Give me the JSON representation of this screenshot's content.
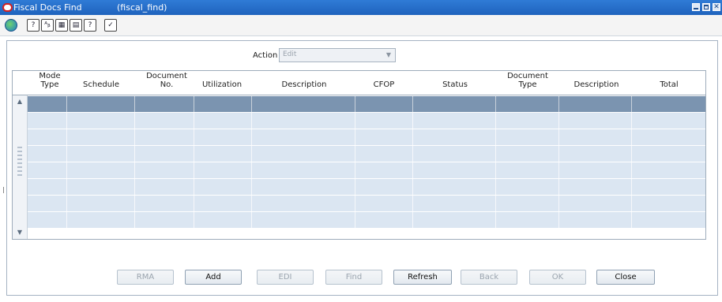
{
  "window": {
    "title": "Fiscal Docs Find",
    "form_name": "(fiscal_find)",
    "controls": [
      "minimize",
      "maximize",
      "close"
    ],
    "close_glyph": "✕"
  },
  "toolbar": {
    "icons": [
      {
        "name": "globe-icon",
        "glyph": ""
      },
      {
        "name": "help-icon",
        "glyph": "?"
      },
      {
        "name": "spell-check-icon",
        "glyph": "ᴬᵦ"
      },
      {
        "name": "calendar-icon",
        "glyph": "▦"
      },
      {
        "name": "print-icon",
        "glyph": "▤"
      },
      {
        "name": "question-icon",
        "glyph": "?"
      },
      {
        "name": "edit-check-icon",
        "glyph": "✓"
      }
    ]
  },
  "action": {
    "label": "Action",
    "value": "Edit",
    "arrow": "▼"
  },
  "table": {
    "columns": [
      {
        "line1": "Mode",
        "line2": "Type"
      },
      {
        "line1": "",
        "line2": "Schedule"
      },
      {
        "line1": "Document",
        "line2": "No."
      },
      {
        "line1": "",
        "line2": "Utilization"
      },
      {
        "line1": "",
        "line2": "Description"
      },
      {
        "line1": "",
        "line2": "CFOP"
      },
      {
        "line1": "",
        "line2": "Status"
      },
      {
        "line1": "Document",
        "line2": "Type"
      },
      {
        "line1": "",
        "line2": "Description"
      },
      {
        "line1": "",
        "line2": "Total"
      }
    ],
    "rows": 8,
    "selected_row": 0,
    "scroll_up": "▲",
    "scroll_down": "▼"
  },
  "buttons": [
    {
      "name": "rma-button",
      "label": "RMA",
      "enabled": false
    },
    {
      "name": "add-button",
      "label": "Add",
      "enabled": true
    },
    {
      "name": "edi-button",
      "label": "EDI",
      "enabled": false
    },
    {
      "name": "find-button",
      "label": "Find",
      "enabled": false
    },
    {
      "name": "refresh-button",
      "label": "Refresh",
      "enabled": true
    },
    {
      "name": "back-button",
      "label": "Back",
      "enabled": false
    },
    {
      "name": "ok-button",
      "label": "OK",
      "enabled": false
    },
    {
      "name": "close-button",
      "label": "Close",
      "enabled": true
    }
  ],
  "colors": {
    "titlebar": "#2167c6",
    "row": "#dbe6f2",
    "selected_row": "#7b94b0",
    "border": "#9eacbb"
  }
}
